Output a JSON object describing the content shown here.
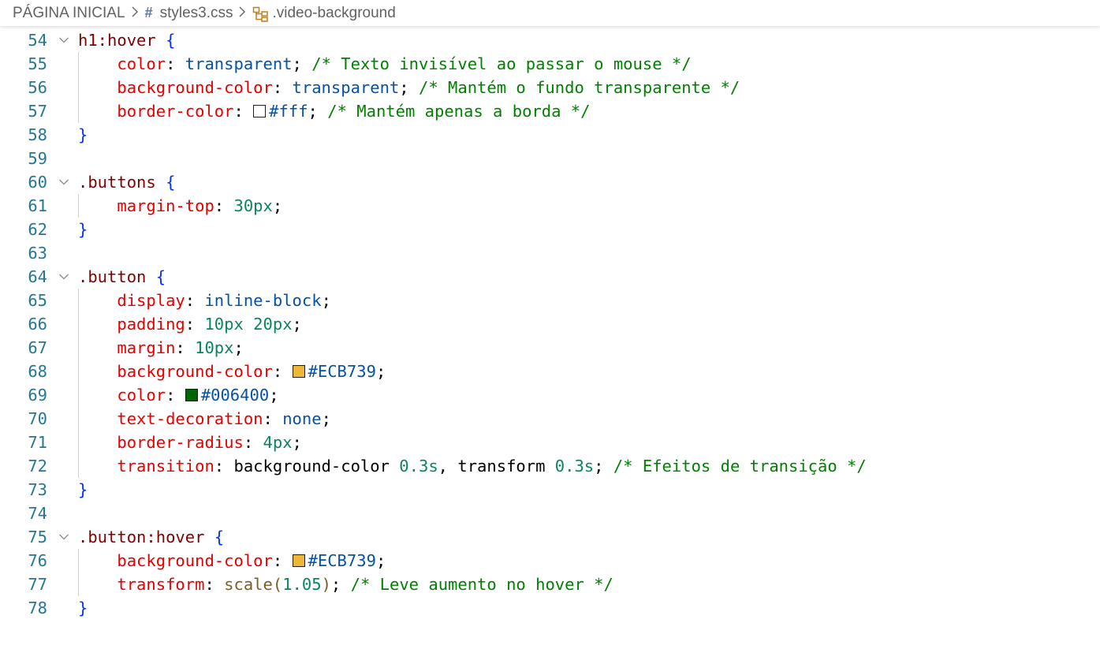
{
  "breadcrumb": {
    "root": "PÁGINA INICIAL",
    "file": "styles3.css",
    "selector": ".video-background",
    "file_icon": "hash-icon",
    "selector_icon": "symbol-class-icon",
    "separator_icon": "chevron-right-icon"
  },
  "lines": [
    {
      "no": "55",
      "fold": false,
      "guide": false,
      "tokens": []
    },
    {
      "no": "54",
      "fold": true,
      "guide": false,
      "tokens": [
        {
          "t": "h1:hover",
          "c": "sel"
        },
        {
          "t": " ",
          "c": "punct"
        },
        {
          "t": "{",
          "c": "brace"
        }
      ]
    },
    {
      "no": "55",
      "fold": false,
      "guide": true,
      "tokens": [
        {
          "t": "    color",
          "c": "prop"
        },
        {
          "t": ": ",
          "c": "punct"
        },
        {
          "t": "transparent",
          "c": "val"
        },
        {
          "t": "; ",
          "c": "punct"
        },
        {
          "t": "/* Texto invisível ao passar o mouse */",
          "c": "cmt"
        }
      ]
    },
    {
      "no": "56",
      "fold": false,
      "guide": true,
      "tokens": [
        {
          "t": "    background-color",
          "c": "prop"
        },
        {
          "t": ": ",
          "c": "punct"
        },
        {
          "t": "transparent",
          "c": "val"
        },
        {
          "t": "; ",
          "c": "punct"
        },
        {
          "t": "/* Mantém o fundo transparente */",
          "c": "cmt"
        }
      ]
    },
    {
      "no": "57",
      "fold": false,
      "guide": true,
      "tokens": [
        {
          "t": "    border-color",
          "c": "prop"
        },
        {
          "t": ": ",
          "c": "punct"
        },
        {
          "swatch": "#ffffff"
        },
        {
          "t": "#fff",
          "c": "val"
        },
        {
          "t": "; ",
          "c": "punct"
        },
        {
          "t": "/* Mantém apenas a borda */",
          "c": "cmt"
        }
      ]
    },
    {
      "no": "58",
      "fold": false,
      "guide": false,
      "tokens": [
        {
          "t": "}",
          "c": "brace"
        }
      ]
    },
    {
      "no": "59",
      "fold": false,
      "guide": false,
      "tokens": []
    },
    {
      "no": "60",
      "fold": true,
      "guide": false,
      "tokens": [
        {
          "t": ".buttons",
          "c": "sel"
        },
        {
          "t": " ",
          "c": "punct"
        },
        {
          "t": "{",
          "c": "brace"
        }
      ]
    },
    {
      "no": "61",
      "fold": false,
      "guide": true,
      "tokens": [
        {
          "t": "    margin-top",
          "c": "prop"
        },
        {
          "t": ": ",
          "c": "punct"
        },
        {
          "t": "30px",
          "c": "num"
        },
        {
          "t": ";",
          "c": "punct"
        }
      ]
    },
    {
      "no": "62",
      "fold": false,
      "guide": false,
      "tokens": [
        {
          "t": "}",
          "c": "brace"
        }
      ]
    },
    {
      "no": "63",
      "fold": false,
      "guide": false,
      "tokens": []
    },
    {
      "no": "64",
      "fold": true,
      "guide": false,
      "tokens": [
        {
          "t": ".button",
          "c": "sel"
        },
        {
          "t": " ",
          "c": "punct"
        },
        {
          "t": "{",
          "c": "brace"
        }
      ]
    },
    {
      "no": "65",
      "fold": false,
      "guide": true,
      "tokens": [
        {
          "t": "    display",
          "c": "prop"
        },
        {
          "t": ": ",
          "c": "punct"
        },
        {
          "t": "inline-block",
          "c": "val"
        },
        {
          "t": ";",
          "c": "punct"
        }
      ]
    },
    {
      "no": "66",
      "fold": false,
      "guide": true,
      "tokens": [
        {
          "t": "    padding",
          "c": "prop"
        },
        {
          "t": ": ",
          "c": "punct"
        },
        {
          "t": "10px",
          "c": "num"
        },
        {
          "t": " ",
          "c": "punct"
        },
        {
          "t": "20px",
          "c": "num"
        },
        {
          "t": ";",
          "c": "punct"
        }
      ]
    },
    {
      "no": "67",
      "fold": false,
      "guide": true,
      "tokens": [
        {
          "t": "    margin",
          "c": "prop"
        },
        {
          "t": ": ",
          "c": "punct"
        },
        {
          "t": "10px",
          "c": "num"
        },
        {
          "t": ";",
          "c": "punct"
        }
      ]
    },
    {
      "no": "68",
      "fold": false,
      "guide": true,
      "tokens": [
        {
          "t": "    background-color",
          "c": "prop"
        },
        {
          "t": ": ",
          "c": "punct"
        },
        {
          "swatch": "#ECB739"
        },
        {
          "t": "#ECB739",
          "c": "val"
        },
        {
          "t": ";",
          "c": "punct"
        }
      ]
    },
    {
      "no": "69",
      "fold": false,
      "guide": true,
      "tokens": [
        {
          "t": "    color",
          "c": "prop"
        },
        {
          "t": ": ",
          "c": "punct"
        },
        {
          "swatch": "#006400"
        },
        {
          "t": "#006400",
          "c": "val"
        },
        {
          "t": ";",
          "c": "punct"
        }
      ]
    },
    {
      "no": "70",
      "fold": false,
      "guide": true,
      "tokens": [
        {
          "t": "    text-decoration",
          "c": "prop"
        },
        {
          "t": ": ",
          "c": "punct"
        },
        {
          "t": "none",
          "c": "val"
        },
        {
          "t": ";",
          "c": "punct"
        }
      ]
    },
    {
      "no": "71",
      "fold": false,
      "guide": true,
      "tokens": [
        {
          "t": "    border-radius",
          "c": "prop"
        },
        {
          "t": ": ",
          "c": "punct"
        },
        {
          "t": "4px",
          "c": "num"
        },
        {
          "t": ";",
          "c": "punct"
        }
      ]
    },
    {
      "no": "72",
      "fold": false,
      "guide": true,
      "tokens": [
        {
          "t": "    transition",
          "c": "prop"
        },
        {
          "t": ": background-color ",
          "c": "punct"
        },
        {
          "t": "0.3s",
          "c": "num"
        },
        {
          "t": ", transform ",
          "c": "punct"
        },
        {
          "t": "0.3s",
          "c": "num"
        },
        {
          "t": "; ",
          "c": "punct"
        },
        {
          "t": "/* Efeitos de transição */",
          "c": "cmt"
        }
      ]
    },
    {
      "no": "73",
      "fold": false,
      "guide": false,
      "tokens": [
        {
          "t": "}",
          "c": "brace"
        }
      ]
    },
    {
      "no": "74",
      "fold": false,
      "guide": false,
      "tokens": []
    },
    {
      "no": "75",
      "fold": true,
      "guide": false,
      "tokens": [
        {
          "t": ".button:hover",
          "c": "sel"
        },
        {
          "t": " ",
          "c": "punct"
        },
        {
          "t": "{",
          "c": "brace"
        }
      ]
    },
    {
      "no": "76",
      "fold": false,
      "guide": true,
      "tokens": [
        {
          "t": "    background-color",
          "c": "prop"
        },
        {
          "t": ": ",
          "c": "punct"
        },
        {
          "swatch": "#ECB739"
        },
        {
          "t": "#ECB739",
          "c": "val"
        },
        {
          "t": ";",
          "c": "punct"
        }
      ]
    },
    {
      "no": "77",
      "fold": false,
      "guide": true,
      "tokens": [
        {
          "t": "    transform",
          "c": "prop"
        },
        {
          "t": ": ",
          "c": "punct"
        },
        {
          "t": "scale(",
          "c": "fn"
        },
        {
          "t": "1.05",
          "c": "num"
        },
        {
          "t": ")",
          "c": "fn"
        },
        {
          "t": "; ",
          "c": "punct"
        },
        {
          "t": "/* Leve aumento no hover */",
          "c": "cmt"
        }
      ]
    },
    {
      "no": "78",
      "fold": false,
      "guide": false,
      "tokens": [
        {
          "t": "}",
          "c": "brace"
        }
      ]
    }
  ]
}
